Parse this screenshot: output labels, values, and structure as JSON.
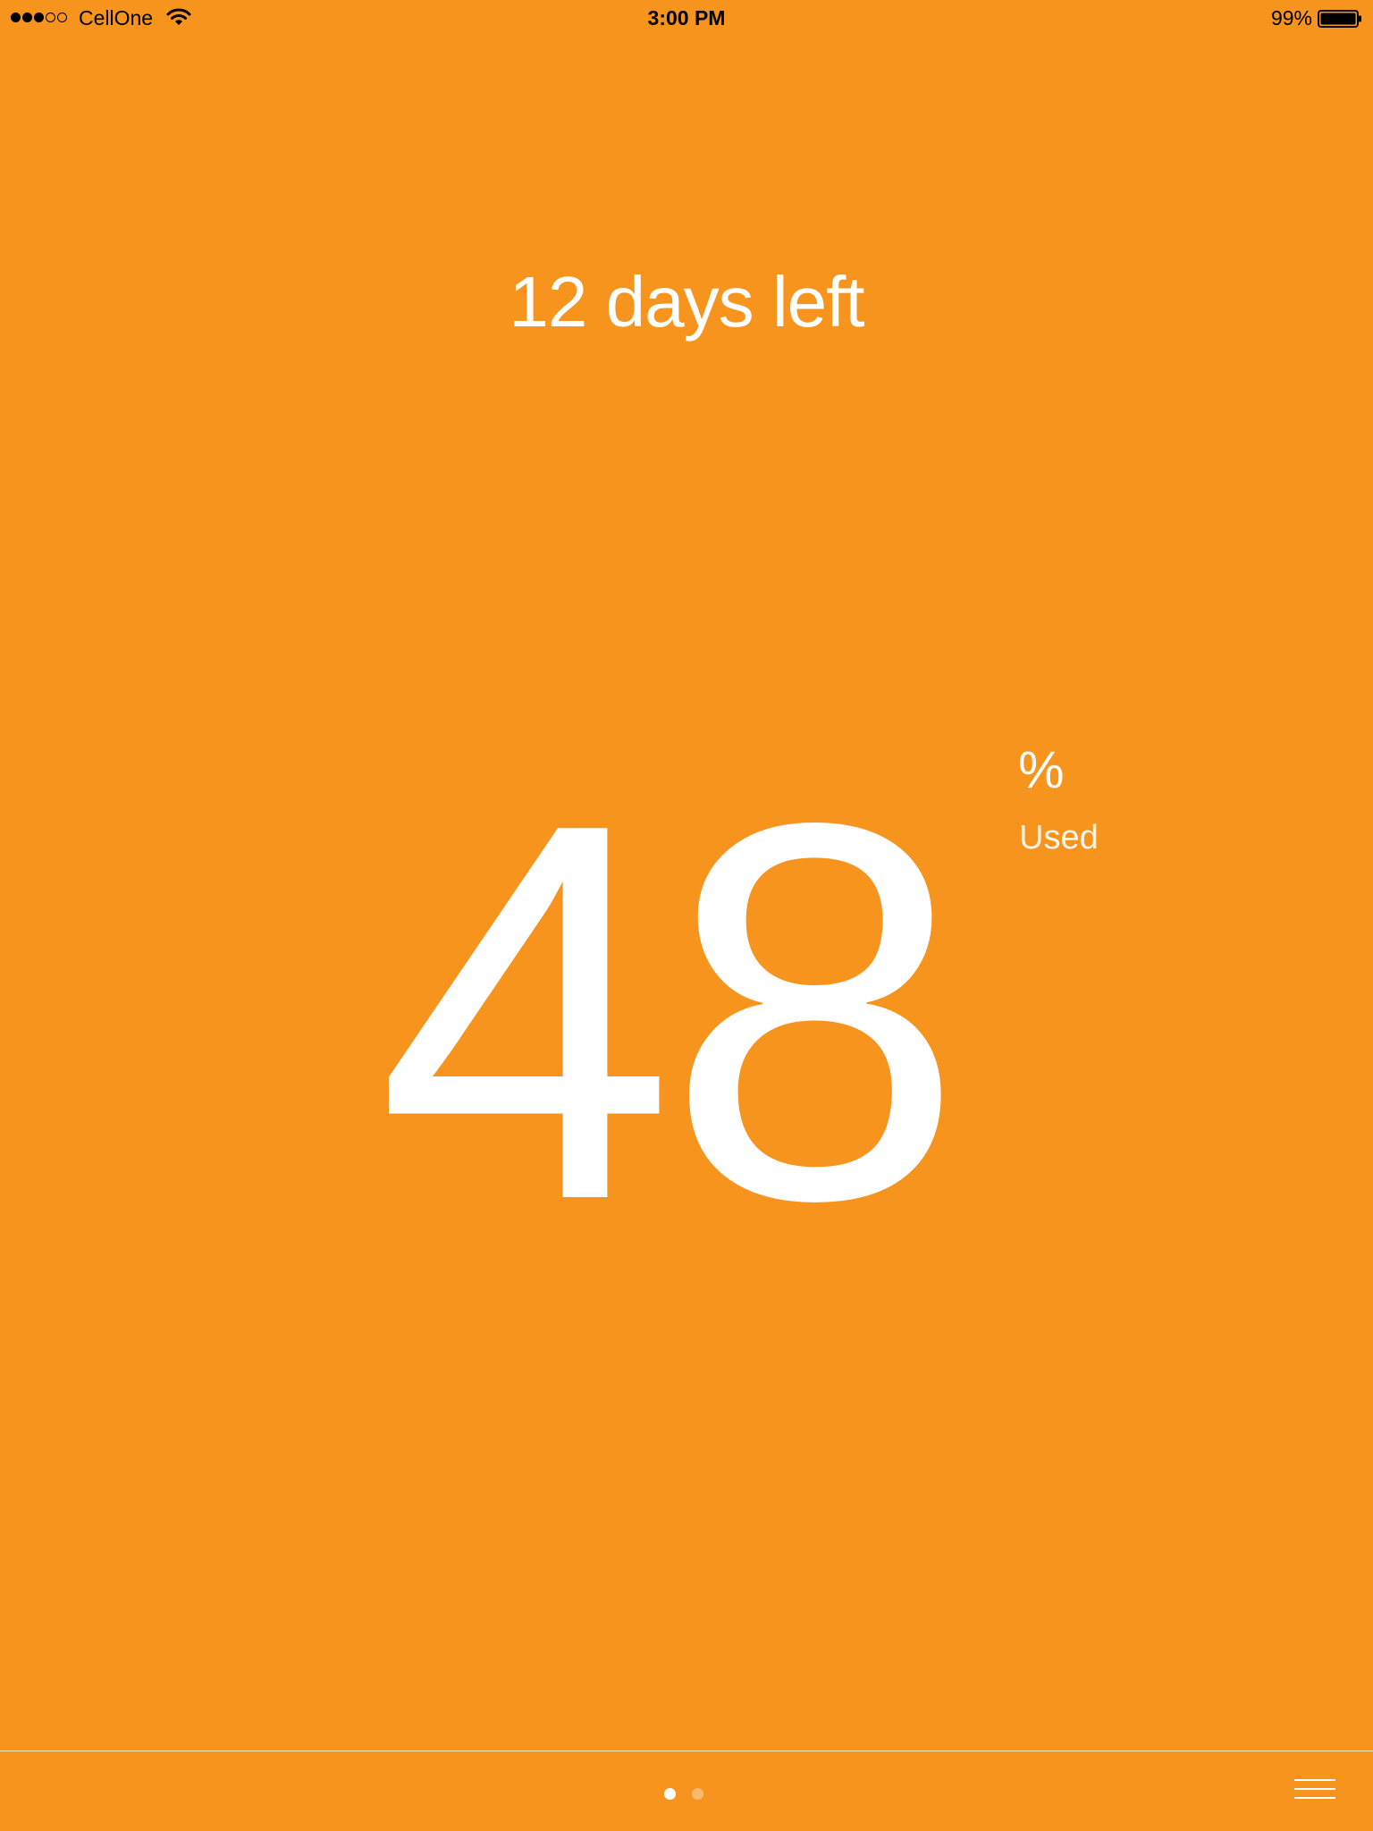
{
  "status_bar": {
    "carrier": "CellOne",
    "time": "3:00 PM",
    "battery_percent": "99%",
    "signal_strength": 3,
    "signal_max": 5
  },
  "main": {
    "days_left": "12 days left",
    "usage_value": "48",
    "usage_unit": "%",
    "usage_label": "Used"
  },
  "pager": {
    "page_count": 2,
    "current_page": 1
  },
  "colors": {
    "background": "#F7941E",
    "foreground": "#FFFFFF",
    "status_text": "#000000"
  },
  "icons": {
    "wifi": "wifi-icon",
    "battery": "battery-icon",
    "menu": "hamburger-menu-icon"
  }
}
